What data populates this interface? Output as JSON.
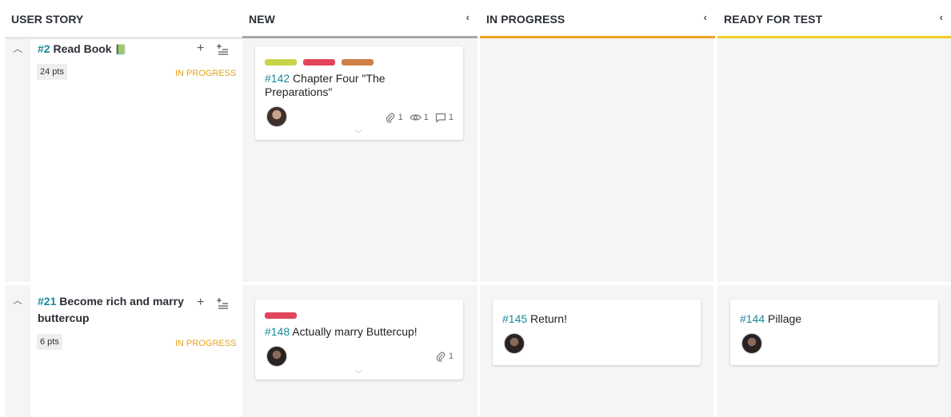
{
  "columns": [
    {
      "name": "USER STORY"
    },
    {
      "name": "NEW",
      "color": "#a8a8a8"
    },
    {
      "name": "IN PROGRESS",
      "color": "#f0a424"
    },
    {
      "name": "READY FOR TEST",
      "color": "#f2cd24"
    }
  ],
  "collapse_glyph": "‹",
  "stories": [
    {
      "ref": "#2",
      "title": "Read Book",
      "emoji": "📗",
      "points": "24 pts",
      "status": "IN PROGRESS"
    },
    {
      "ref": "#21",
      "title_line1": "Become rich and marry",
      "title_line2": "buttercup",
      "points": "6 pts",
      "status": "IN PROGRESS"
    }
  ],
  "cards": {
    "c142": {
      "ref": "#142",
      "title_line1": "Chapter Four \"The",
      "title_line2": "Preparations\"",
      "tags": [
        "#c8d44a",
        "#e2455a",
        "#d08046"
      ],
      "attachments": "1",
      "watchers": "1",
      "comments": "1"
    },
    "c148": {
      "ref": "#148",
      "title": "Actually marry Buttercup!",
      "tags": [
        "#e2455a"
      ],
      "attachments": "1"
    },
    "c145": {
      "ref": "#145",
      "title": "Return!"
    },
    "c144": {
      "ref": "#144",
      "title": "Pillage"
    }
  },
  "colors": {
    "ref": "#1b8a9a",
    "status": "#e8a317"
  }
}
